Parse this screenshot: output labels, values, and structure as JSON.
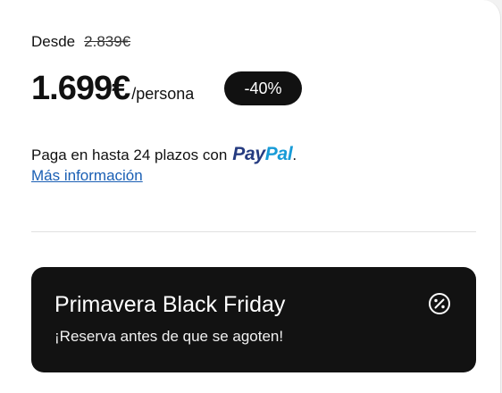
{
  "pricing": {
    "from_label": "Desde",
    "old_price": "2.839€",
    "price": "1.699€",
    "per_unit": "/persona",
    "discount_badge": "-40%"
  },
  "paypal": {
    "text": "Paga en hasta 24 plazos con",
    "brand_pay": "Pay",
    "brand_pal": "Pal",
    "suffix": ".",
    "more_link": "Más información"
  },
  "promo": {
    "title": "Primavera Black Friday",
    "subtitle": "¡Reserva antes de que se agoten!",
    "icon": "percent-icon"
  },
  "colors": {
    "promo_background": "#121212",
    "badge_background": "#111111",
    "link": "#1a5fb4",
    "paypal_dark": "#253b80",
    "paypal_light": "#179bd7"
  }
}
